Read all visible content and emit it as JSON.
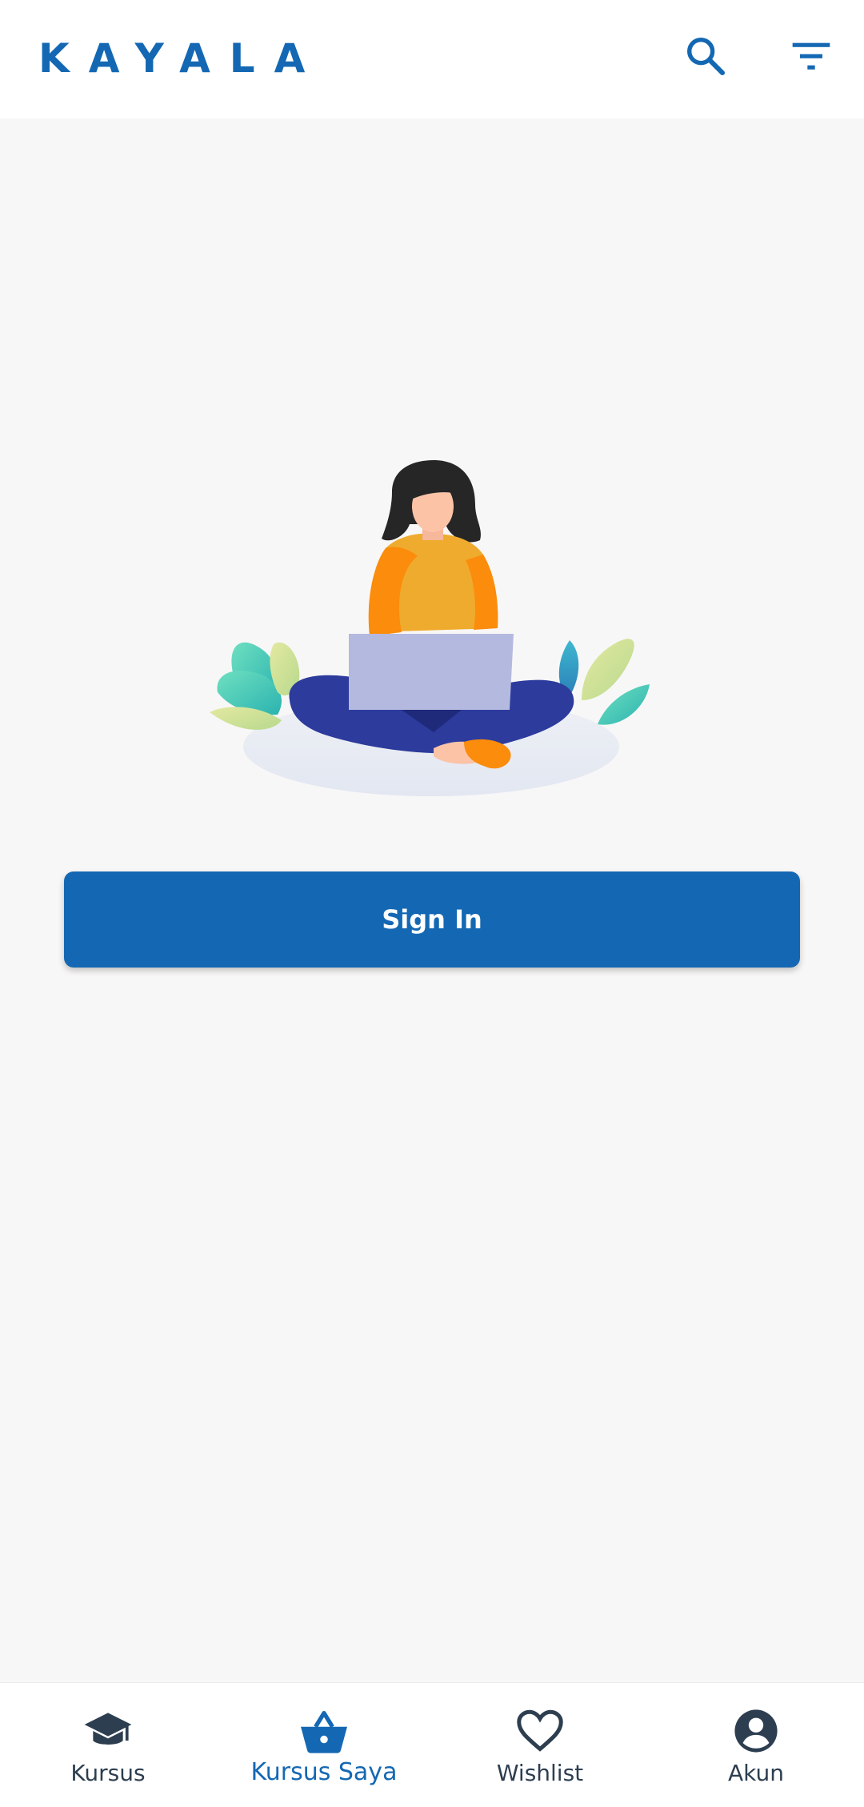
{
  "header": {
    "logo_text": "KAYALA",
    "search_icon": "search-icon",
    "filter_icon": "filter-icon"
  },
  "main": {
    "illustration": "person-with-laptop-illustration",
    "sign_in_label": "Sign In"
  },
  "bottom_nav": {
    "items": [
      {
        "label": "Kursus",
        "icon": "graduation-cap-icon",
        "active": false
      },
      {
        "label": "Kursus Saya",
        "icon": "basket-icon",
        "active": true
      },
      {
        "label": "Wishlist",
        "icon": "heart-icon",
        "active": false
      },
      {
        "label": "Akun",
        "icon": "account-circle-icon",
        "active": false
      }
    ]
  },
  "colors": {
    "brand": "#1468b3",
    "background": "#f8f7f7",
    "nav_inactive": "#2d3e50"
  }
}
